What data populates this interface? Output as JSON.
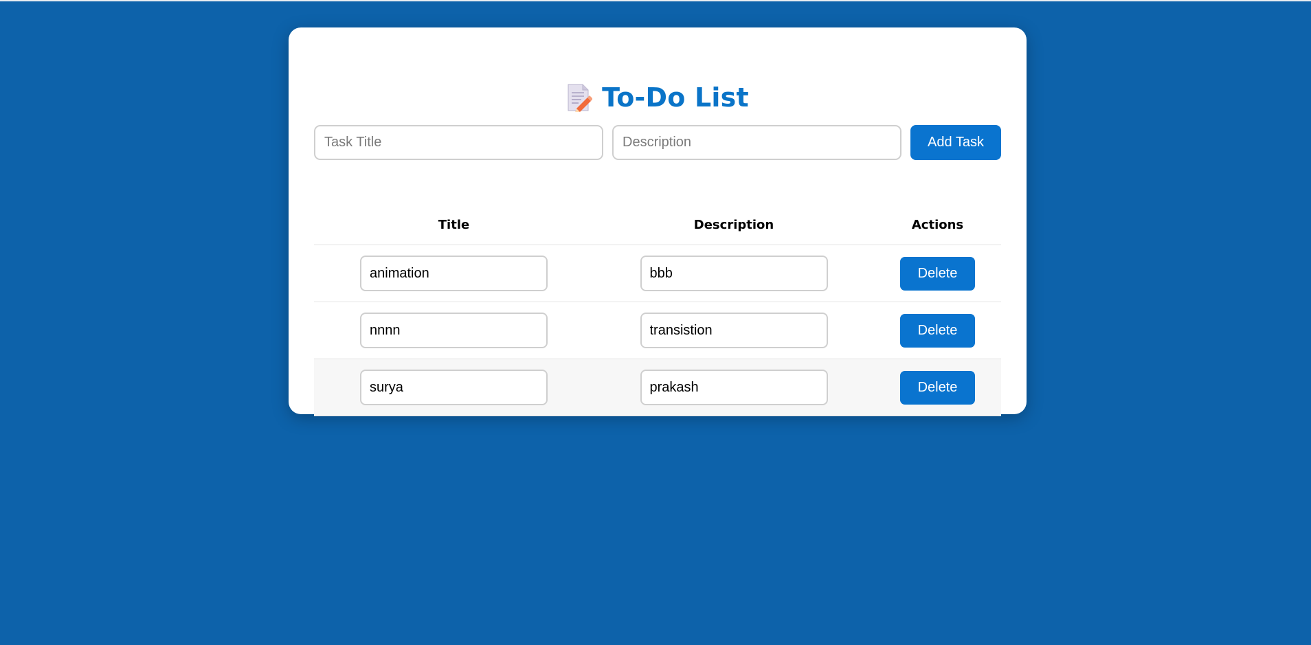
{
  "header": {
    "icon": "memo-icon",
    "title": "To-Do List"
  },
  "form": {
    "title_placeholder": "Task Title",
    "description_placeholder": "Description",
    "add_label": "Add Task"
  },
  "table": {
    "columns": [
      "Title",
      "Description",
      "Actions"
    ],
    "rows": [
      {
        "title": "animation",
        "description": "bbb",
        "action": "Delete"
      },
      {
        "title": "nnnn",
        "description": "transistion",
        "action": "Delete"
      },
      {
        "title": "surya",
        "description": "prakash",
        "action": "Delete"
      }
    ]
  },
  "colors": {
    "background": "#0d62aa",
    "accent": "#0a74cf",
    "title": "#0a74c8"
  }
}
